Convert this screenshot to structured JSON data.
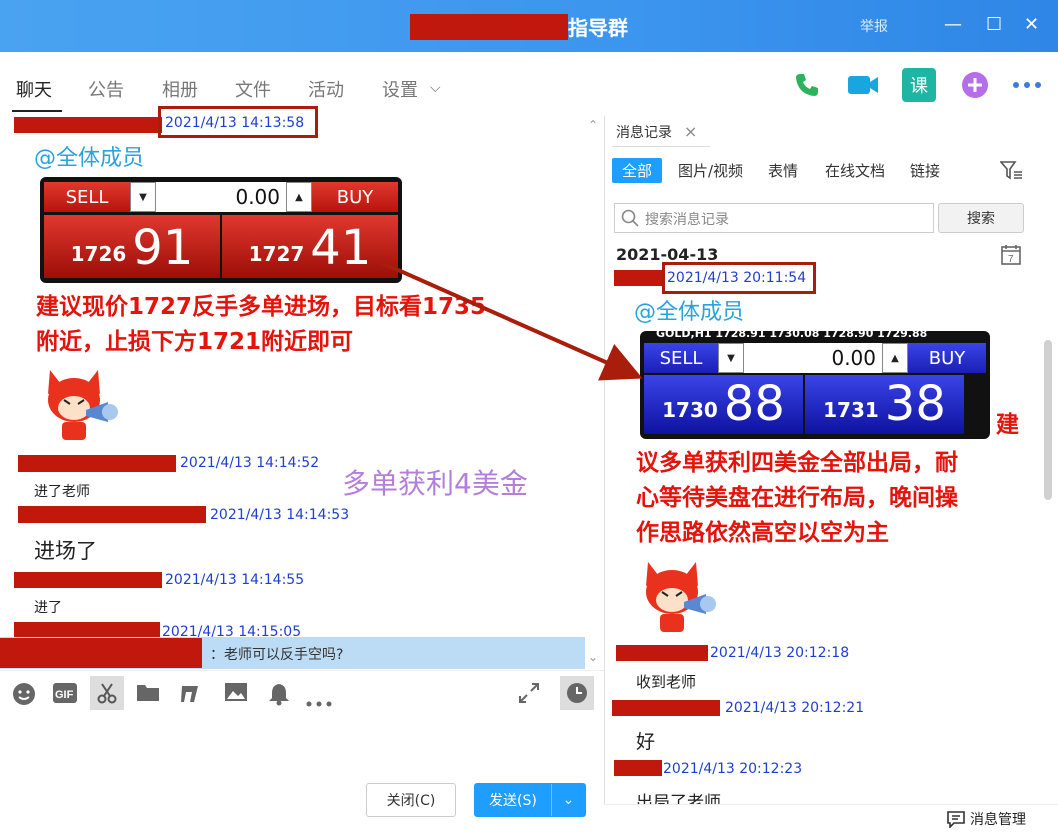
{
  "window": {
    "title": "指导群",
    "report": "举报",
    "minimize": "—",
    "maximize": "☐",
    "close": "✕"
  },
  "tabs": [
    "聊天",
    "公告",
    "相册",
    "文件",
    "活动",
    "设置"
  ],
  "tabs_chevron": "⌵",
  "top_icons": [
    "phone-icon",
    "video-icon",
    "class-icon",
    "add-icon",
    "more-icon"
  ],
  "class_icon_label": "课",
  "left": {
    "ts1": "2021/4/13 14:13:58",
    "mention": "@全体成员",
    "panel1": {
      "sell": "SELL",
      "buy": "BUY",
      "value": "0.00",
      "sell_small": "1726",
      "sell_big": "91",
      "buy_small": "1727",
      "buy_big": "41"
    },
    "annot1_line1": "建议现价1727反手多单进场，目标看1735",
    "annot1_line2": "附近，止损下方1721附近即可",
    "ts2": "2021/4/13 14:14:52",
    "msg2": "进了老师",
    "profit": "多单获利4美金",
    "ts3": "2021/4/13 14:14:53",
    "msg3": "进场了",
    "ts4": "2021/4/13 14:14:55",
    "msg4": "进了",
    "ts5": "2021/4/13 14:15:05",
    "reply": "：老师可以反手空吗?",
    "close_btn": "关闭(C)",
    "send_btn": "发送(S)"
  },
  "right": {
    "panel_title": "消息记录",
    "close_x": "×",
    "filters": [
      "全部",
      "图片/视频",
      "表情",
      "在线文档",
      "链接"
    ],
    "search_placeholder": "搜索消息记录",
    "search_btn": "搜索",
    "date": "2021-04-13",
    "calendar_day": "7",
    "ts1": "2021/4/13 20:11:54",
    "mention": "@全体成员",
    "panel_header": "GOLD,H1 1728.91 1730.08 1728.90 1729.88",
    "panel2": {
      "sell": "SELL",
      "buy": "BUY",
      "value": "0.00",
      "sell_small": "1730",
      "sell_big": "88",
      "buy_small": "1731",
      "buy_big": "38"
    },
    "annot_line0": "建",
    "annot_line1": "议多单获利四美金全部出局，耐",
    "annot_line2": "心等待美盘在进行布局，晚间操",
    "annot_line3": "作思路依然高空以空为主",
    "ts2": "2021/4/13 20:12:18",
    "msg2": "收到老师",
    "ts3": "2021/4/13 20:12:21",
    "msg3": "好",
    "ts4": "2021/4/13 20:12:23",
    "msg4": "出局了老师",
    "manage": "消息管理"
  },
  "colors": {
    "titlebar": "#3c95ee",
    "redaction": "#c0180c",
    "timestamp": "#1f3fd0",
    "annotation": "#e4130b",
    "box": "#a91d0b",
    "profit": "#b57edc"
  }
}
